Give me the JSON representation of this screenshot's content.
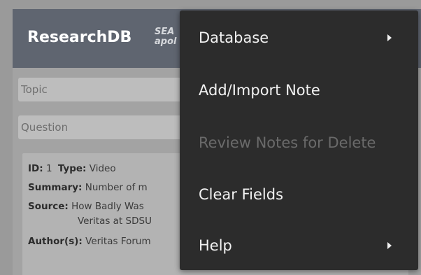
{
  "app": {
    "title": "ResearchDB",
    "subtitle_line1": "SEA",
    "subtitle_line2": "apol"
  },
  "fields": {
    "topic_placeholder": "Topic",
    "question_placeholder": "Question"
  },
  "card": {
    "id_label": "ID:",
    "id_value": "1",
    "type_label": "Type:",
    "type_value": "Video",
    "summary_label": "Summary:",
    "summary_value": "Number of m",
    "source_label": "Source:",
    "source_value_line1": "How Badly Was",
    "source_value_line2": "Veritas at SDSU",
    "author_label": "Author(s):",
    "author_value": "Veritas Forum"
  },
  "menu": {
    "items": [
      {
        "label": "Database",
        "has_submenu": true,
        "enabled": true
      },
      {
        "label": "Add/Import Note",
        "has_submenu": false,
        "enabled": true
      },
      {
        "label": "Review Notes for Delete",
        "has_submenu": false,
        "enabled": false
      },
      {
        "label": "Clear Fields",
        "has_submenu": false,
        "enabled": true
      },
      {
        "label": "Help",
        "has_submenu": true,
        "enabled": true
      }
    ]
  },
  "colors": {
    "appbar": "#5f6570",
    "menu_bg": "#2c2c2c",
    "menu_text": "#f2f2f2",
    "menu_disabled_text": "#6a6a6a"
  }
}
